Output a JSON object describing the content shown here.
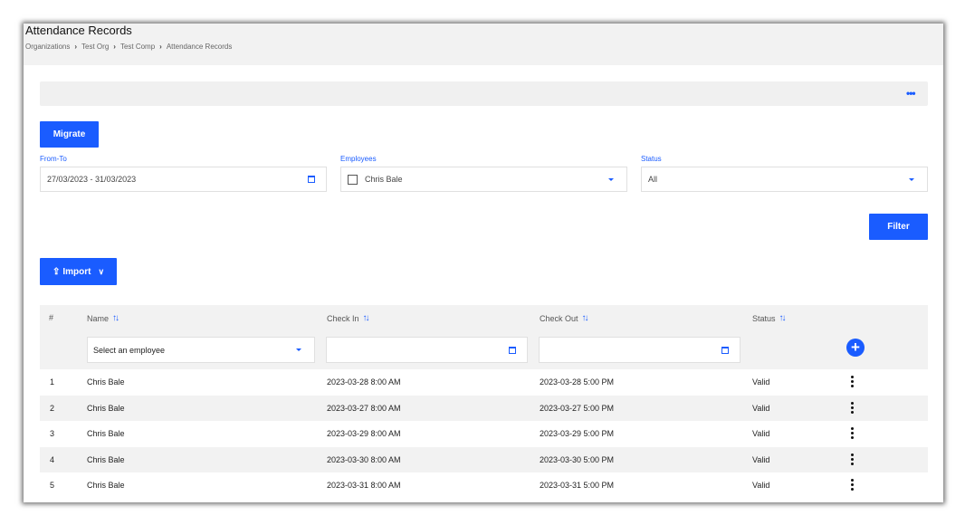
{
  "header": {
    "title": "Attendance Records",
    "breadcrumb": [
      "Organizations",
      "Test Org",
      "Test Comp",
      "Attendance Records"
    ]
  },
  "toolbar": {
    "more_icon": "horizontal-dots-icon"
  },
  "actions": {
    "migrate_label": "Migrate",
    "filter_label": "Filter",
    "import_label": "Import"
  },
  "filters": {
    "from_to": {
      "label": "From-To",
      "value": "27/03/2023 - 31/03/2023"
    },
    "employees": {
      "label": "Employees",
      "value": "Chris Bale"
    },
    "status": {
      "label": "Status",
      "value": "All"
    }
  },
  "table": {
    "columns": [
      "#",
      "Name",
      "Check In",
      "Check Out",
      "Status"
    ],
    "name_filter_placeholder": "Select an employee",
    "rows": [
      {
        "num": "1",
        "name": "Chris Bale",
        "check_in": "2023-03-28 8:00 AM",
        "check_out": "2023-03-28 5:00 PM",
        "status": "Valid"
      },
      {
        "num": "2",
        "name": "Chris Bale",
        "check_in": "2023-03-27 8:00 AM",
        "check_out": "2023-03-27 5:00 PM",
        "status": "Valid"
      },
      {
        "num": "3",
        "name": "Chris Bale",
        "check_in": "2023-03-29 8:00 AM",
        "check_out": "2023-03-29 5:00 PM",
        "status": "Valid"
      },
      {
        "num": "4",
        "name": "Chris Bale",
        "check_in": "2023-03-30 8:00 AM",
        "check_out": "2023-03-30 5:00 PM",
        "status": "Valid"
      },
      {
        "num": "5",
        "name": "Chris Bale",
        "check_in": "2023-03-31 8:00 AM",
        "check_out": "2023-03-31 5:00 PM",
        "status": "Valid"
      }
    ]
  },
  "colors": {
    "accent": "#1a5cff",
    "header_bg": "#f2f2f2"
  }
}
